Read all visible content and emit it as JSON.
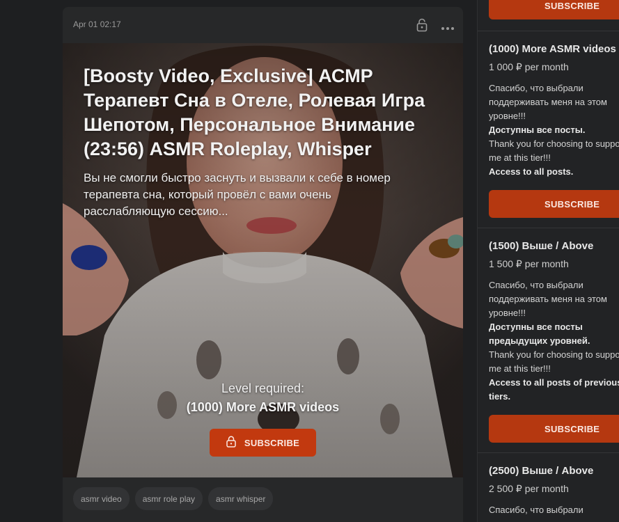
{
  "post": {
    "date": "Apr 01 02:17",
    "title": "[Boosty Video, Exclusive] АСМР Терапевт Сна в Отеле, Ролевая Игра Шепотом, Персональное Внимание (23:56) ASMR Roleplay, Whisper",
    "teaser": "Вы не смогли быстро заснуть и вызвали к себе в номер терапевта сна, который провёл с вами очень расслабляющую сессию...",
    "level_required_label": "Level required:",
    "level_required_name": "(1000) More ASMR videos",
    "subscribe_label": "SUBSCRIBE",
    "tags": [
      "asmr video",
      "asmr role play",
      "asmr whisper"
    ],
    "icons": {
      "lock": "lock-icon",
      "more": "more-dots-icon",
      "subscribe_lock": "lock-icon"
    }
  },
  "sidebar": {
    "top_button_label": "SUBSCRIBE",
    "tiers": [
      {
        "name": "(1000) More ASMR videos",
        "price": "1 000 ₽ per month",
        "desc_lines": [
          "Спасибо, что выбрали поддерживать меня на этом уровне!!!",
          "Доступны все посты.",
          "Thank you for choosing to support me at this tier!!!",
          "Access to all posts."
        ],
        "button_label": "SUBSCRIBE"
      },
      {
        "name": "(1500) Выше / Above",
        "price": "1 500 ₽ per month",
        "desc_lines": [
          "Спасибо, что выбрали поддерживать меня на этом уровне!!!",
          "Доступны все посты предыдущих уровней.",
          "Thank you for choosing to support me at this tier!!!",
          "Access to all posts of previous tiers."
        ],
        "button_label": "SUBSCRIBE"
      },
      {
        "name": "(2500) Выше / Above",
        "price": "2 500 ₽ per month",
        "desc_lines": [
          "Спасибо, что выбрали"
        ],
        "button_label": ""
      }
    ]
  },
  "colors": {
    "background": "#1e1f21",
    "card": "#272829",
    "accent": "#c2390f",
    "sidebar_button": "#b53810"
  }
}
